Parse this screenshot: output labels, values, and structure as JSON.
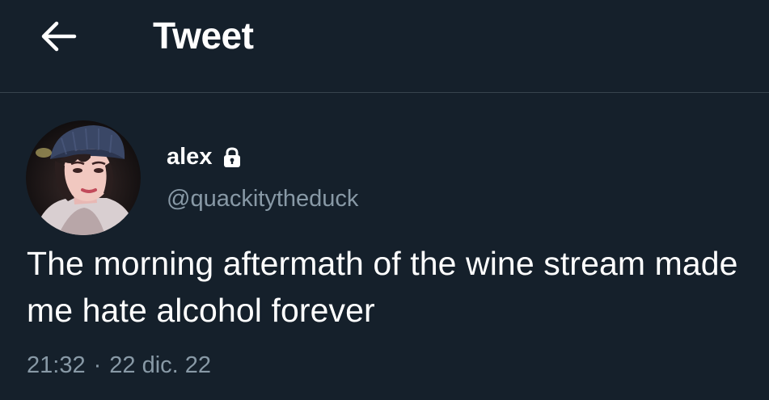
{
  "header": {
    "title": "Tweet",
    "back_icon": "arrow-left-icon"
  },
  "tweet": {
    "author": {
      "name": "alex",
      "handle": "@quackitytheduck",
      "protected_icon": "lock-icon"
    },
    "text": "The morning aftermath of the wine stream made me hate alcohol forever",
    "time": "21:32",
    "separator": "·",
    "date": "22 dic. 22"
  },
  "colors": {
    "background": "#15202b",
    "divider": "#38444d",
    "primary_text": "#ffffff",
    "secondary_text": "#8899a6"
  }
}
